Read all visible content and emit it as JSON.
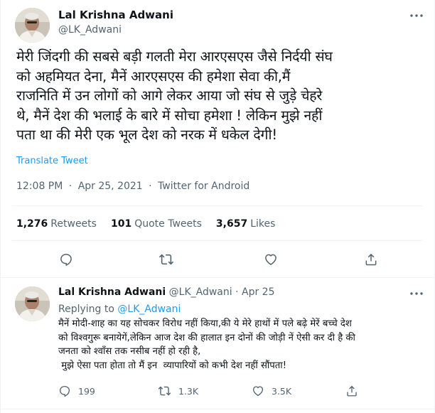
{
  "main_tweet": {
    "author_name": "Lal Krishna Adwani",
    "author_handle": "@LK_Adwani",
    "text_lines": [
      "मेरी जिंदगी की सबसे बड़ी गलती मेरा आरएसएस जैसे निर्दयी संघ",
      "को अहमियत देना,  मैनें आरएसएस की हमेशा सेवा की,मैं",
      "राजनिति में उन लोगों को आगे लेकर आया जो संघ से जुड़े चेहरे",
      "थे, मैनें देश की भलाई के बारे में सोचा हमेशा ! लेकिन मुझे नहीं",
      "पता था की मेरी एक भूल देश को नरक में धकेल देगी!"
    ],
    "translate_label": "Translate Tweet",
    "time": "12:08 PM",
    "date": "Apr 25, 2021",
    "source": "Twitter for Android",
    "separator": "·",
    "stats": {
      "retweets_count": "1,276",
      "retweets_label": "Retweets",
      "quotes_count": "101",
      "quotes_label": "Quote Tweets",
      "likes_count": "3,657",
      "likes_label": "Likes"
    },
    "actions": [
      "reply-icon",
      "retweet-icon",
      "like-icon",
      "share-icon"
    ]
  },
  "reply_tweet": {
    "author_name": "Lal Krishna Adwani",
    "author_handle": "@LK_Adwani",
    "separator": "·",
    "date": "Apr 25",
    "replying_label": "Replying to",
    "replying_handle": "@LK_Adwani",
    "text_lines": [
      "मैनें  मोदी-शाह का यह सोचकर विरोध  नहीं किया,की ये मेरे हाथों में पले बढ़े मेरें बच्चे देश",
      "को विश्वगुरू  बनायेगें,लेकिन आज देश की हालात इन दोनों की जोड़ी नें ऐसी कर दी है की",
      "जनता को श्वाँस तक नसीब नहीं हो रही है,",
      " मुझे ऐसा पता होता तो मैं इन  व्यापारियों को कभी देश नहीं सौंपता!"
    ],
    "replies": "199",
    "retweets": "1.3K",
    "likes": "3.5K"
  },
  "colors": {
    "accent": "#1d9bf0",
    "muted": "#536471",
    "text": "#0f1419",
    "divider": "#eff3f4"
  }
}
